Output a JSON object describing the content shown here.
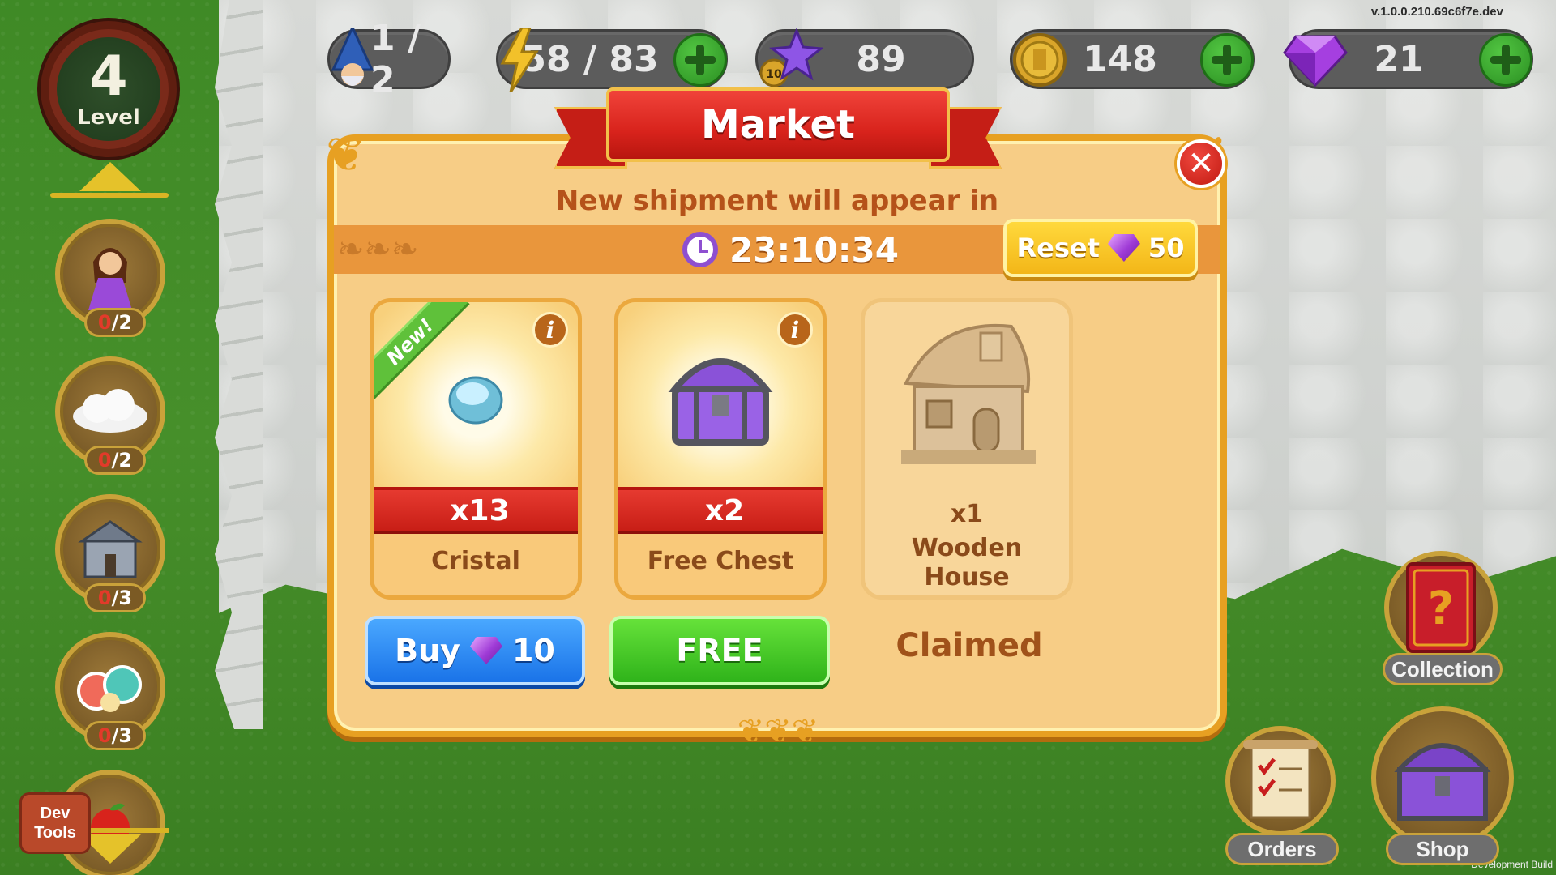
{
  "version": "v.1.0.0.210.69c6f7e.dev",
  "dev_build": "Development Build",
  "resources": {
    "wizards": "1 / 2",
    "energy": "58 / 83",
    "stars": "89",
    "star_badge": "10",
    "coins": "148",
    "gems": "21"
  },
  "level": {
    "number": "4",
    "label": "Level"
  },
  "quests": [
    {
      "icon": "princess-icon",
      "done": "0",
      "total": "/2"
    },
    {
      "icon": "cloud-icon",
      "done": "0",
      "total": "/2"
    },
    {
      "icon": "stone-house-icon",
      "done": "0",
      "total": "/3"
    },
    {
      "icon": "candy-icon",
      "done": "0",
      "total": "/3"
    }
  ],
  "devtools": {
    "line1": "Dev",
    "line2": "Tools"
  },
  "side_buttons": {
    "collection": "Collection",
    "orders": "Orders",
    "shop": "Shop"
  },
  "market": {
    "title": "Market",
    "subtitle": "New shipment will appear in",
    "timer": "23:10:34",
    "reset_label": "Reset",
    "reset_cost": "50",
    "items": [
      {
        "new_tag": "New!",
        "qty": "x13",
        "name": "Cristal",
        "info": "i",
        "action": "Buy",
        "cost": "10"
      },
      {
        "qty": "x2",
        "name": "Free Chest",
        "info": "i",
        "action": "FREE"
      },
      {
        "qty": "x1",
        "name_line1": "Wooden",
        "name_line2": "House",
        "action": "Claimed"
      }
    ]
  },
  "colors": {
    "accent_red": "#d8231c",
    "gold": "#e7a022",
    "buy_blue": "#1a73e8",
    "free_green": "#2fb31a",
    "gem_purple": "#9f3bd6"
  }
}
